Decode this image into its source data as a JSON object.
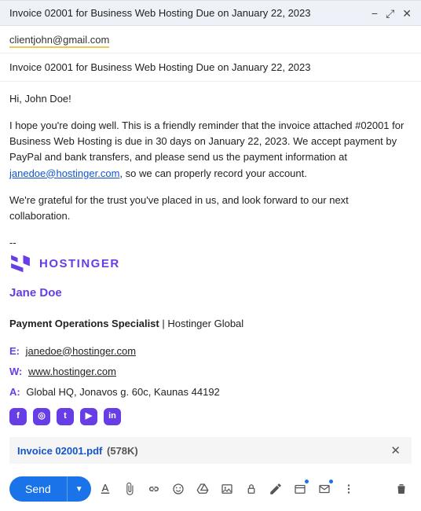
{
  "header": {
    "title": "Invoice 02001 for Business Web Hosting Due on January 22, 2023"
  },
  "recipient": "clientjohn@gmail.com",
  "subject": "Invoice 02001 for Business Web Hosting Due on January 22, 2023",
  "body": {
    "greeting": "Hi, John Doe!",
    "para1_a": "I hope you're doing well. This is a friendly reminder that the invoice attached #02001 for Business Web Hosting is due in 30 days on January 22, 2023. We accept payment by PayPal and bank transfers, and please send us the payment information at ",
    "sender_email": "janedoe@hostinger.com",
    "para1_b": ", so we can properly record your account.",
    "para2": "We're grateful for the trust you've placed in us, and look forward to our next collaboration.",
    "sep": "--"
  },
  "signature": {
    "brand": "HOSTINGER",
    "name": "Jane Doe",
    "title_bold": "Payment Operations Specialist",
    "title_rest": " | Hostinger Global",
    "e_label": "E:",
    "email": "janedoe@hostinger.com",
    "w_label": "W:",
    "web": "www.hostinger.com",
    "a_label": "A:",
    "address": "Global HQ, Jonavos g. 60c, Kaunas 44192",
    "social": {
      "facebook": "f",
      "instagram": "◎",
      "twitter": "t",
      "youtube": "▶",
      "linkedin": "in"
    }
  },
  "attachment": {
    "name": "Invoice 02001.pdf",
    "size": "(578K)"
  },
  "toolbar": {
    "send": "Send"
  }
}
